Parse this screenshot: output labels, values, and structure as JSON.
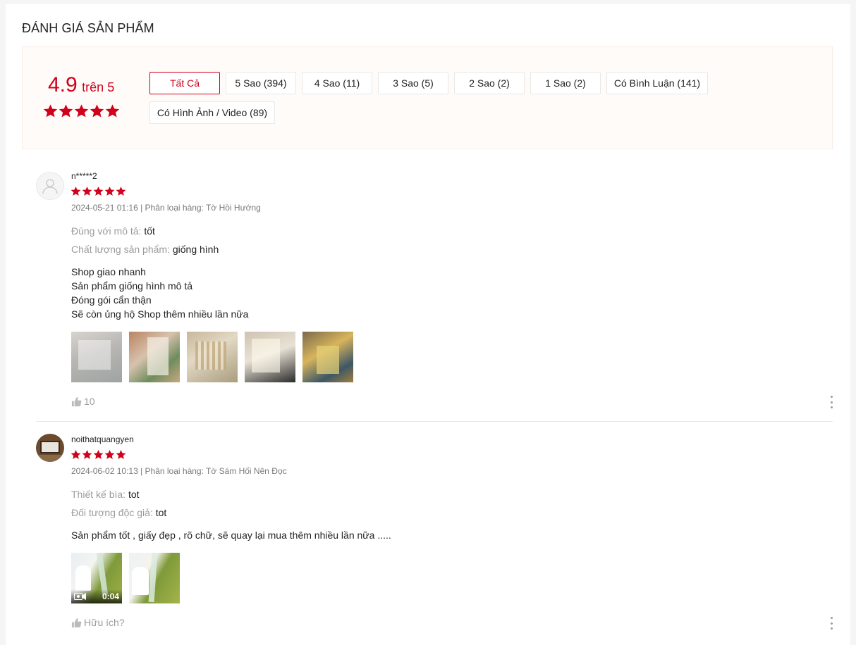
{
  "section": {
    "title": "ĐÁNH GIÁ SẢN PHẨM"
  },
  "overview": {
    "score": "4.9",
    "out_of": "trên 5",
    "stars": 5,
    "filters": [
      {
        "label": "Tất Cả",
        "active": true
      },
      {
        "label": "5 Sao (394)",
        "active": false
      },
      {
        "label": "4 Sao (11)",
        "active": false
      },
      {
        "label": "3 Sao (5)",
        "active": false
      },
      {
        "label": "2 Sao (2)",
        "active": false
      },
      {
        "label": "1 Sao (2)",
        "active": false
      },
      {
        "label": "Có Bình Luận (141)",
        "active": false
      },
      {
        "label": "Có Hình Ảnh / Video (89)",
        "active": false
      }
    ]
  },
  "colors": {
    "accent": "#d0011b",
    "muted": "#999999"
  },
  "reviews": [
    {
      "username": "n*****2",
      "avatar": "default-user-icon",
      "rating": 5,
      "meta": "2024-05-21 01:16 | Phân loại hàng: Tờ Hồi Hướng",
      "attributes": [
        {
          "key": "Đúng với mô tả:",
          "value": "tốt"
        },
        {
          "key": "Chất lượng sản phẩm:",
          "value": "giống hình"
        }
      ],
      "body": [
        "Shop giao nhanh",
        "Sản phẩm giống hình mô tả",
        "Đóng gói cẩn thận",
        "Sẽ còn ủng hộ Shop thêm nhiều lần nữa"
      ],
      "media_count": 5,
      "likes": "10"
    },
    {
      "username": "noithatquangyen",
      "avatar": "user-photo",
      "rating": 5,
      "meta": "2024-06-02 10:13 | Phân loại hàng: Tờ Sám Hối Nên Đọc",
      "attributes": [
        {
          "key": "Thiết kế bìa:",
          "value": "tot"
        },
        {
          "key": "Đối tượng độc giả:",
          "value": "tot"
        }
      ],
      "body": [
        "Sản phẩm tốt , giấy đẹp , rõ chữ, sẽ quay lại mua thêm nhiều lần nữa ....."
      ],
      "media_count": 2,
      "video_duration": "0:04",
      "likes": "Hữu ích?"
    }
  ]
}
